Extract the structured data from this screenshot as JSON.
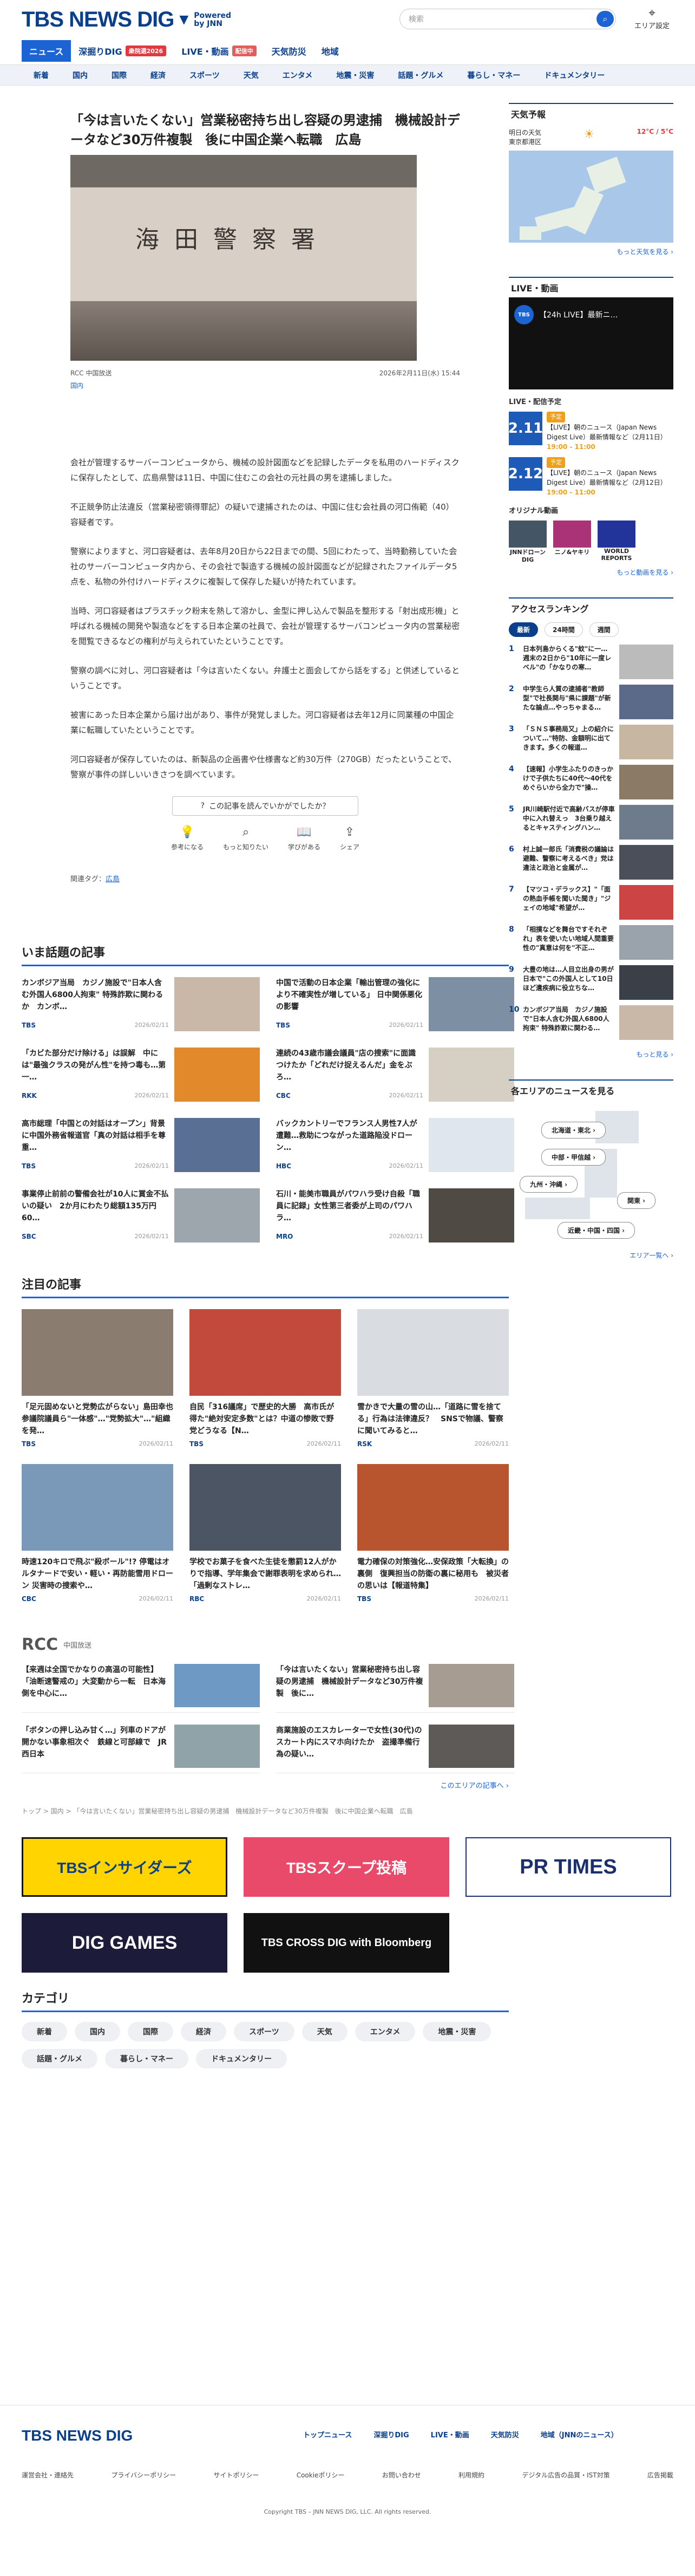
{
  "header": {
    "logo": "TBS NEWS DIG",
    "powered": "Powered\nby JNN",
    "search_placeholder": "検索",
    "region_label": "エリア設定",
    "gnav": [
      {
        "label": "ニュース",
        "active": true
      },
      {
        "label": "深掘りDIG",
        "badge": "衆院選2026"
      },
      {
        "label": "LIVE・動画",
        "badge": "配信中"
      },
      {
        "label": "天気防災"
      },
      {
        "label": "地域"
      }
    ],
    "snav": [
      "新着",
      "国内",
      "国際",
      "経済",
      "スポーツ",
      "天気",
      "エンタメ",
      "地震・災害",
      "話題・グルメ",
      "暮らし・マネー",
      "ドキュメンタリー"
    ]
  },
  "article": {
    "title": "「今は言いたくない」営業秘密持ち出し容疑の男逮捕　機械設計データなど30万件複製　後に中国企業へ転職　広島",
    "hero_sign": "海田警察署",
    "source": "RCC 中国放送",
    "date": "2026年2月11日(水) 15:44",
    "tag": "国内",
    "paragraphs": [
      "会社が管理するサーバーコンピュータから、機械の設計図面などを記録したデータを私用のハードディスクに保存したとして、広島県警は11日、中国に住むこの会社の元社員の男を逮捕しました。",
      "不正競争防止法違反（営業秘密領得罪記）の疑いで逮捕されたのは、中国に住む会社員の河口侑範（40）容疑者です。",
      "警察によりますと、河口容疑者は、去年8月20日から22日までの間、5回にわたって、当時勤務していた会社のサーバーコンピュータ内から、その会社で製造する機械の設計図面などが記録されたファイルデータ5点を、私物の外付けハードディスクに複製して保存した疑いが持たれています。",
      "当時、河口容疑者はプラスチック粉末を熱して溶かし、金型に押し込んで製品を整形する「射出成形機」と呼ばれる機械の開発や製造などをする日本企業の社員で、会社が管理するサーバコンピュータ内の営業秘密を閲覧できるなどの権利が与えられていたということです。",
      "警察の調べに対し、河口容疑者は「今は言いたくない。弁護士と面会してから話をする」と供述しているということです。",
      "被害にあった日本企業から届け出があり、事件が発覚しました。河口容疑者は去年12月に同業種の中国企業に転職していたということです。",
      "河口容疑者が保存していたのは、新製品の企画書や仕様書など約30万件（270GB）だったということで、警察が事件の詳しいいきさつを調べています。"
    ],
    "feedback_btn": "この記事を読んでいかがでしたか？",
    "reactions": [
      "参考になる",
      "もっと知りたい",
      "学びがある",
      "シェア"
    ],
    "related_tag_label": "関連タグ：",
    "related_tag": "広島"
  },
  "trending": {
    "title": "いま話題の記事",
    "items": [
      {
        "text": "カンボジア当局　カジノ施設で\"日本人含む外国人6800人拘束\" 特殊詐欺に関わるか　カンボ…",
        "src": "TBS",
        "date": "2026/02/11"
      },
      {
        "text": "中国で活動の日本企業「輸出管理の強化により不確実性が増している」 日中関係悪化の影響",
        "src": "TBS",
        "date": "2026/02/11"
      },
      {
        "text": "「カビた部分だけ除ける」は誤解　中には\"最強クラスの発がん性\"を持つ毒も…第一…",
        "src": "RKK",
        "date": "2026/02/11"
      },
      {
        "text": "連続の43歳市議会議員\"店の捜索\"に面識つけたか「どれだけ捉えるんだ」金をぶろ…",
        "src": "CBC",
        "date": "2026/02/11"
      },
      {
        "text": "高市総理「中国との対話はオープン」背景に中国外務省報道官「真の対話は相手を尊重…",
        "src": "TBS",
        "date": "2026/02/11"
      },
      {
        "text": "バックカントリーでフランス人男性7人が遭難…救助につながった道路陥没ドローン…",
        "src": "HBC",
        "date": "2026/02/11"
      },
      {
        "text": "事業停止前前の警備会社が10人に賞金不払いの疑い　2か月にわたり総額135万円　60…",
        "src": "SBC",
        "date": "2026/02/11"
      },
      {
        "text": "石川・能美市職員がパワハラ受け自殺「職員に記録」女性第三者委が上司のパワハラ…",
        "src": "MRO",
        "date": "2026/02/11"
      }
    ]
  },
  "featured": {
    "title": "注目の記事",
    "items": [
      {
        "text": "「足元固めないと党勢広がらない」島田幸也参議院議員ら\"一体感\"…\"党勢拡大\"…\"組織を発…",
        "src": "TBS",
        "date": "2026/02/11"
      },
      {
        "text": "自民「316議席」で歴史的大勝　高市氏が得た\"絶対安定多数\"とは？中道の惨敗で野党どうなる【N…",
        "src": "TBS",
        "date": "2026/02/11"
      },
      {
        "text": "雪かきで大量の雪の山…「道路に雪を捨てる」行為は法律違反？　SNSで物議、警察に聞いてみると…",
        "src": "RSK",
        "date": "2026/02/11"
      },
      {
        "text": "時速120キロで飛ぶ\"殺ボール\"!? 停電はオルタナードで安い・軽い・再防能雪用ドローン 災害時の捜索や…",
        "src": "CBC",
        "date": "2026/02/11"
      },
      {
        "text": "学校でお菓子を食べた生徒を懲罰12人がかりで指導、学年集会で謝罪表明を求められ…「過剰なストレ…",
        "src": "RBC",
        "date": "2026/02/11"
      },
      {
        "text": "電力確保の対策強化…安保政策「大転換」の裏側　復興担当の防衛の裏に秘用も　被災者の思いは【報道特集】",
        "src": "TBS",
        "date": "2026/02/11"
      }
    ]
  },
  "rcc": {
    "logo": "RCC",
    "label": "中国放送",
    "items": [
      {
        "text": "【来週は全国でかなりの高温の可能性】「油断速警戒の」大変動から一転　日本海側を中心に…"
      },
      {
        "text": "「今は言いたくない」営業秘密持ち出し容疑の男逮捕　機械設計データなど30万件複製　後に…"
      },
      {
        "text": "「ボタンの押し込み甘く…」列車のドアが開かない事象相次ぐ　鉄線と可部線で　JR西日本"
      },
      {
        "text": "商業施設のエスカレーターで女性(30代)のスカート内にスマホ向けたか　盗撮準備行為の疑い…"
      }
    ],
    "more": "このエリアの記事へ ›"
  },
  "breadcrumb": "トップ > 国内 > 「今は言いたくない」営業秘密持ち出し容疑の男逮捕　機械設計データなど30万件複製　後に中国企業へ転職　広島",
  "banners": [
    "TBSインサイダーズ",
    "TBSスクープ投稿",
    "PR TIMES",
    "DIG GAMES",
    "TBS CROSS DIG with Bloomberg"
  ],
  "categories": {
    "title": "カテゴリ",
    "items": [
      "新着",
      "国内",
      "国際",
      "経済",
      "スポーツ",
      "天気",
      "エンタメ",
      "地震・災害",
      "話題・グルメ",
      "暮らし・マネー",
      "ドキュメンタリー"
    ]
  },
  "footer": {
    "logo": "TBS NEWS DIG",
    "nav": [
      "トップニュース",
      "深掘りDIG",
      "LIVE・動画",
      "天気防災",
      "地域（JNNのニュース）"
    ],
    "sub": [
      "運営会社・連絡先",
      "プライバシーポリシー",
      "サイトポリシー",
      "Cookieポリシー",
      "お問い合わせ",
      "利用規約",
      "デジタル広告の品質・IST対策",
      "広告掲載"
    ],
    "copyright": "Copyright TBS – JNN NEWS DIG, LLC. All rights reserved."
  },
  "sidebar": {
    "weather_title": "天気予報",
    "weather_day": "明日の天気\n東京都港区",
    "weather_temp": "12°C / 5°C",
    "weather_more": "もっと天気を見る ›",
    "live_title": "LIVE・動画",
    "live_card": "【24h LIVE】最新ニ…",
    "schedule_title": "LIVE・配信予定",
    "schedule": [
      {
        "date": "2.11",
        "pill": "予定",
        "text": "【LIVE】朝のニュース（Japan News Digest Live）最新情報など（2月11日）",
        "time": "19:00 - 11:00"
      },
      {
        "date": "2.12",
        "pill": "予定",
        "text": "【LIVE】朝のニュース（Japan News Digest Live）最新情報など（2月12日）",
        "time": "19:00 - 11:00"
      }
    ],
    "original_title": "オリジナル動画",
    "original": [
      "JNNドローンDIG",
      "ニノ&ヤキリ",
      "WORLD REPORTS"
    ],
    "original_more": "もっと動画を見る ›",
    "ranking_title": "アクセスランキング",
    "ranking_tabs": [
      "最新",
      "24時間",
      "週間"
    ],
    "ranking": [
      "日本列島からくる\"蚊\"に一…　週末の2日から\"10年に一度レベル\"の「かなりの寒…",
      "中学生ら人質の逮捕者\"教師型\"で社長関与\"県に課題\"が新たな論点…やっちゃまる…",
      "「ＳＮＳ事務局又」上の紹介について…\"特防、金額明に出てきます。多くの報道…",
      "【速報】小学生ふたりのきっかけで子供たちに40代～40代をめぐらいから全力で\"操…",
      "JR川崎駅付近で高齢バスが停車中に入れ替えっ　3台乗り越えるとキャスティングハン…",
      "村上誠一郎氏「消費税の議論は避難、警察に考えるべき」党は違法と政治と金属が…",
      "【マツコ・デラックス】\"「面の熱血手帳を聞いた聞き」\"ジェイの地域\"希望が…",
      "「相撲などを舞台ですそれぞれ」表を使いたい地域人間重要性の\"真意は何を\"不正…",
      "大豊の地は…人目立出身の男が日本で\"この外国人として10日ほど遺疾病に役立ちな…",
      "カンボジア当局　カジノ施設で\"日本人含む外国人6800人拘束\" 特殊詐欺に関わる…"
    ],
    "ranking_more": "もっと見る ›",
    "area_title": "各エリアのニュースを見る",
    "areas": [
      "北海道・東北 ›",
      "中部・甲信越 ›",
      "九州・沖縄 ›",
      "関東 ›",
      "近畿・中国・四国 ›"
    ],
    "area_more": "エリア一覧へ ›"
  }
}
